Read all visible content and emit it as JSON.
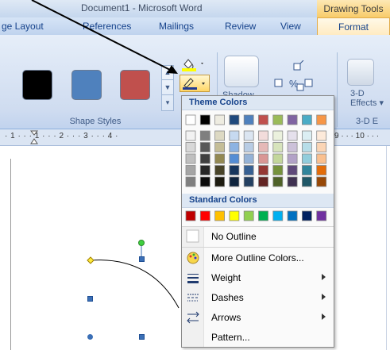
{
  "window": {
    "title": "Document1 - Microsoft Word",
    "context_tab": "Drawing Tools"
  },
  "tabs": [
    {
      "label": "ge Layout"
    },
    {
      "label": "References"
    },
    {
      "label": "Mailings"
    },
    {
      "label": "Review"
    },
    {
      "label": "View"
    },
    {
      "label": "Format"
    }
  ],
  "ribbon": {
    "shape_styles_label": "Shape Styles",
    "shadow_label": "Shadow",
    "d3_label": "3-D",
    "d3_sublabel": "Effects",
    "d3_group_label": "3-D E",
    "swatches": [
      {
        "name": "black",
        "color": "#000000"
      },
      {
        "name": "blue",
        "color": "#4f81bd"
      },
      {
        "name": "red",
        "color": "#c0504d"
      }
    ]
  },
  "ruler": {
    "text": "· 1 · · · 1 · · · 2 · · · 3 · · · 4 ·",
    "right_text": "9 · · · 10 · · ·"
  },
  "menu": {
    "theme_heading": "Theme Colors",
    "standard_heading": "Standard Colors",
    "theme_top_row": [
      "#ffffff",
      "#000000",
      "#eeece1",
      "#1f497d",
      "#4f81bd",
      "#c0504d",
      "#9bbb59",
      "#8064a2",
      "#4bacc6",
      "#f79646"
    ],
    "theme_shades": [
      [
        "#f2f2f2",
        "#7f7f7f",
        "#ddd9c3",
        "#c6d9f0",
        "#dbe5f1",
        "#f2dcdb",
        "#ebf1dd",
        "#e5e0ec",
        "#dbeef3",
        "#fdeada"
      ],
      [
        "#d8d8d8",
        "#595959",
        "#c4bd97",
        "#8db3e2",
        "#b8cce4",
        "#e5b9b7",
        "#d7e3bc",
        "#ccc1d9",
        "#b7dde8",
        "#fbd5b5"
      ],
      [
        "#bfbfbf",
        "#3f3f3f",
        "#938953",
        "#548dd4",
        "#95b3d7",
        "#d99694",
        "#c3d69b",
        "#b2a2c7",
        "#92cddc",
        "#fac08f"
      ],
      [
        "#a5a5a5",
        "#262626",
        "#494429",
        "#17365d",
        "#366092",
        "#953734",
        "#76923c",
        "#5f497a",
        "#31859b",
        "#e36c09"
      ],
      [
        "#7f7f7f",
        "#0c0c0c",
        "#1d1b10",
        "#0f243e",
        "#244061",
        "#632423",
        "#4f6128",
        "#3f3151",
        "#205867",
        "#974806"
      ]
    ],
    "standard_colors": [
      "#c00000",
      "#ff0000",
      "#ffc000",
      "#ffff00",
      "#92d050",
      "#00b050",
      "#00b0f0",
      "#0070c0",
      "#002060",
      "#7030a0"
    ],
    "items": [
      {
        "label": "No Outline",
        "icon": "empty-square-icon"
      },
      {
        "label": "More Outline Colors...",
        "icon": "palette-icon"
      },
      {
        "label": "Weight",
        "icon": "lines-weight-icon"
      },
      {
        "label": "Dashes",
        "icon": "dashes-icon"
      },
      {
        "label": "Arrows",
        "icon": "arrows-icon"
      },
      {
        "label": "Pattern...",
        "icon": ""
      }
    ]
  }
}
